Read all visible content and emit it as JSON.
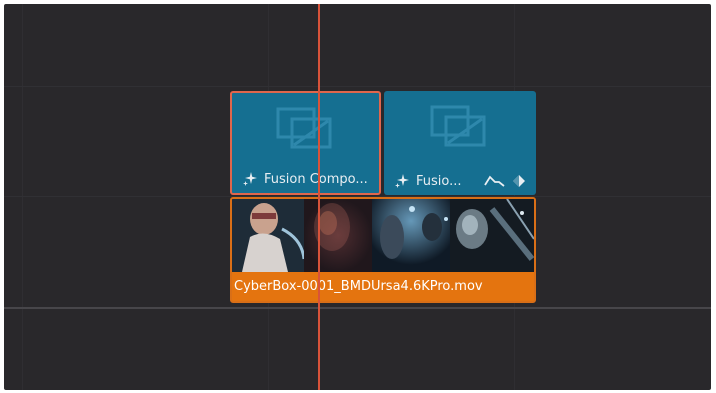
{
  "timeline": {
    "clips": {
      "fusion_1": {
        "label": "Fusion Compo..."
      },
      "fusion_2": {
        "label": "Fusio..."
      },
      "video": {
        "label": "CyberBox-0001_BMDUrsa4.6KPro.mov"
      }
    }
  },
  "colors": {
    "background": "#29282b",
    "fusion_clip": "#156f91",
    "selected_border": "#e0664c",
    "video_clip": "#e4740f",
    "playhead": "#d8533a"
  },
  "icons": {
    "fusion_thumb": "fusion-composition-icon",
    "sparkle": "sparkle-icon",
    "curve": "curve-icon",
    "keyframe": "keyframe-diamond-icon"
  }
}
